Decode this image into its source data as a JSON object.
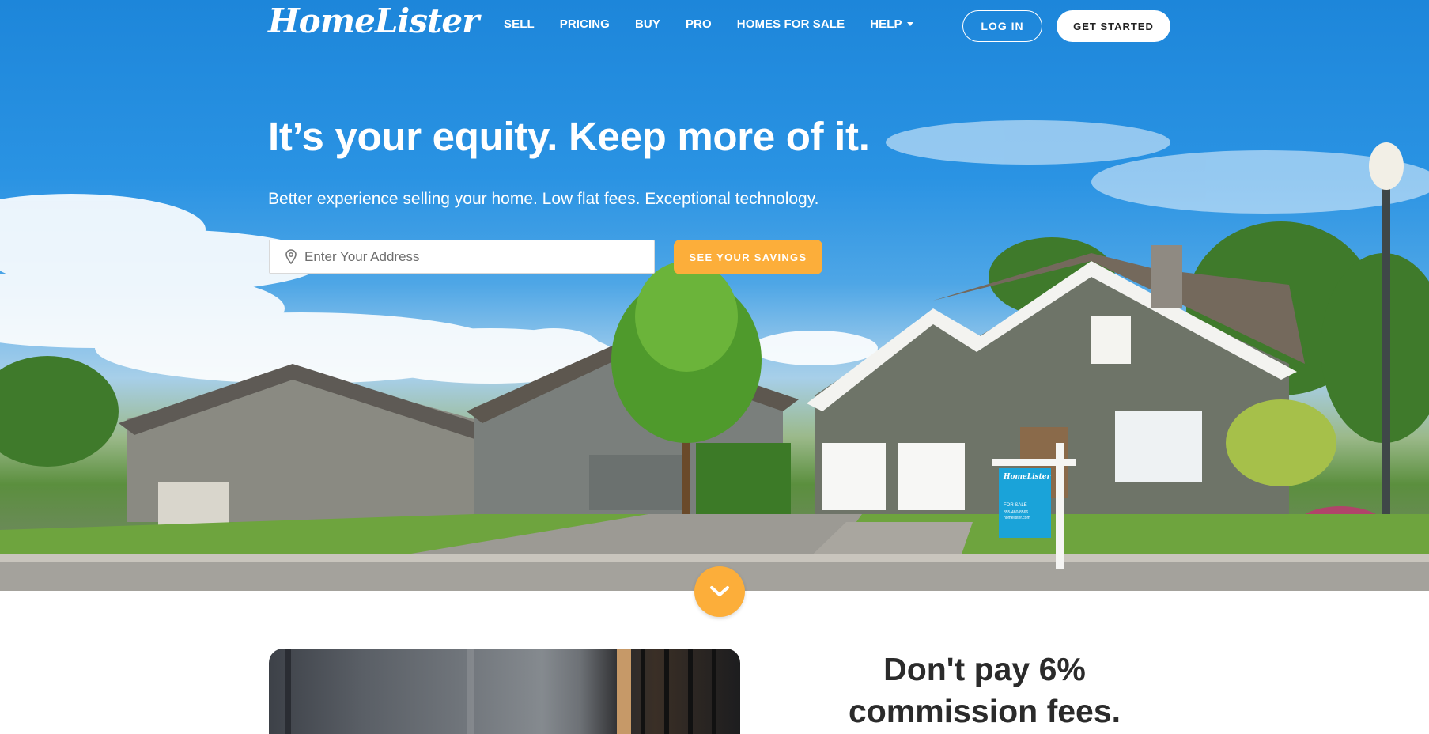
{
  "brand": {
    "logo_text": "HomeLister"
  },
  "nav": {
    "items": [
      {
        "label": "SELL"
      },
      {
        "label": "PRICING"
      },
      {
        "label": "BUY"
      },
      {
        "label": "PRO"
      },
      {
        "label": "HOMES FOR SALE"
      },
      {
        "label": "HELP"
      }
    ],
    "login_label": "LOG IN",
    "get_started_label": "GET STARTED"
  },
  "hero": {
    "headline": "It’s your equity. Keep more of it.",
    "subheadline": "Better experience selling your home. Low flat fees. Exceptional technology.",
    "address_placeholder": "Enter Your Address",
    "address_value": "",
    "cta_label": "SEE YOUR SAVINGS",
    "sign": {
      "brand": "HomeLister",
      "line1": "FOR SALE",
      "line2": "855-480-8566",
      "line3": "homelister.com"
    }
  },
  "section2": {
    "heading_line1": "Don't pay 6%",
    "heading_line2": "commission fees."
  },
  "icons": {
    "location": "location-pin-icon",
    "scroll": "chevron-down-icon",
    "help_caret": "caret-down-icon"
  },
  "colors": {
    "accent": "#fcae3a",
    "sky": "#1d86da",
    "sign": "#1aa3d9",
    "heading": "#2b2b2b"
  }
}
